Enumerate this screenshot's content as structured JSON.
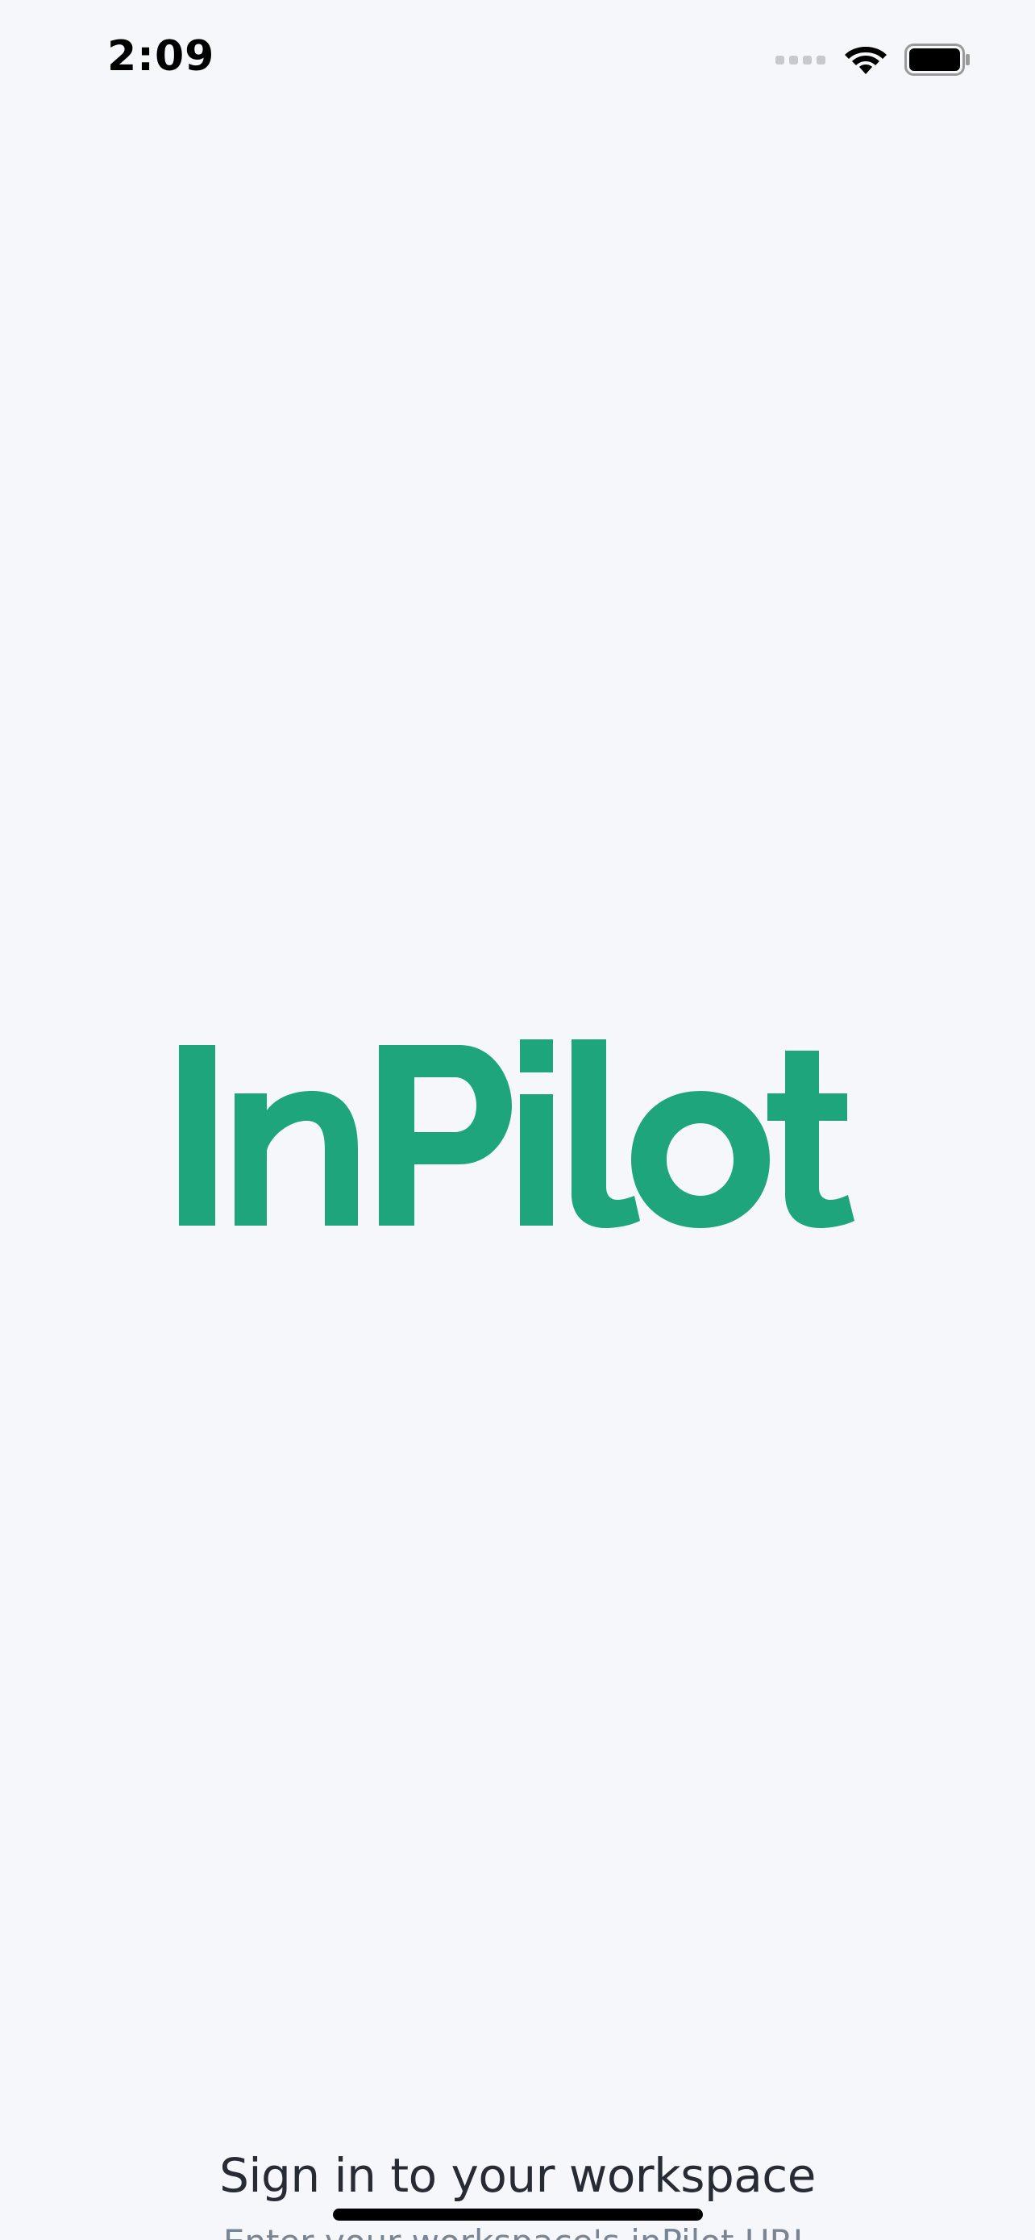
{
  "status_bar": {
    "time": "2:09",
    "icons": [
      "cellular-signal-icon",
      "wifi-icon",
      "battery-icon"
    ]
  },
  "logo": {
    "text": "InPilot",
    "color": "#1fa57b"
  },
  "sign_in": {
    "title": "Sign in to your workspace",
    "subtitle": "Enter your workspace's inPilot URL"
  },
  "colors": {
    "background": "#f5f7fa",
    "brand": "#1fa57b",
    "title_text": "#262b34",
    "subtitle_text": "#7a8594"
  }
}
